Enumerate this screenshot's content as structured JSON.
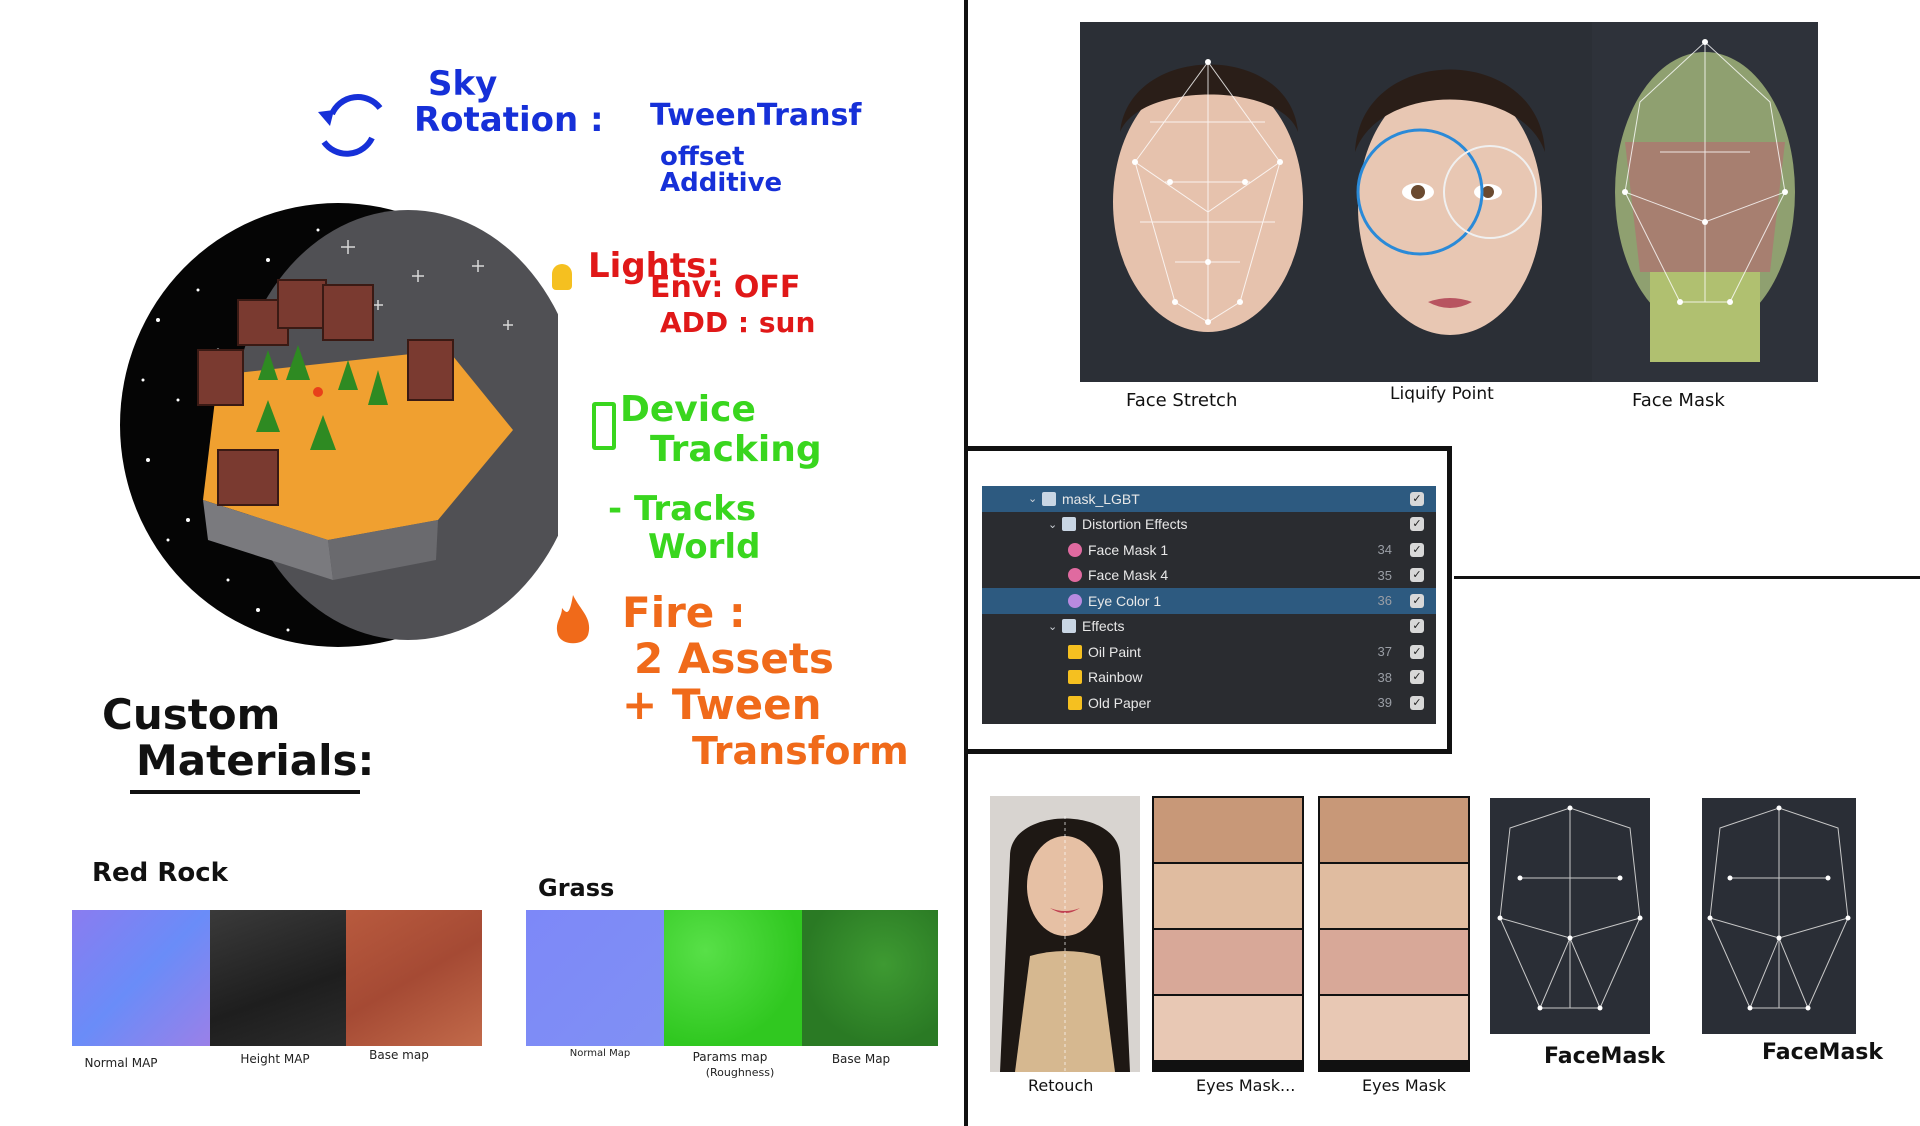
{
  "sketch": {
    "sky_rotation": {
      "title_line1": "Sky",
      "title_line2": "Rotation :",
      "items": [
        "TweenTransf",
        "offset",
        "Additive"
      ]
    },
    "lights": {
      "title": "Lights:",
      "items": [
        "Env: OFF",
        "ADD : sun"
      ]
    },
    "device_tracking": {
      "line1": "Device",
      "line2": "Tracking",
      "line3": "- Tracks",
      "line4": "World"
    },
    "fire": {
      "line1": "Fire :",
      "line2": "2 Assets",
      "line3": "+ Tween",
      "line4": "Transform"
    },
    "custom_materials": {
      "line1": "Custom",
      "line2": "Materials:"
    }
  },
  "materials": {
    "red_rock": {
      "title": "Red Rock",
      "labels": [
        "Normal MAP",
        "Height MAP",
        "Base map"
      ]
    },
    "grass": {
      "title": "Grass",
      "labels": [
        "Normal Map",
        "Params map",
        "(Roughness)",
        "Base Map"
      ]
    }
  },
  "faces": {
    "labels": [
      "Face Stretch",
      "Liquify Point",
      "Face Mask"
    ]
  },
  "layers": {
    "root": "mask_LGBT",
    "rows": [
      {
        "label": "Distortion Effects",
        "num": "",
        "level": 1,
        "kind": "group"
      },
      {
        "label": "Face Mask 1",
        "num": "34",
        "level": 2,
        "kind": "facemask"
      },
      {
        "label": "Face Mask 4",
        "num": "35",
        "level": 2,
        "kind": "facemask"
      },
      {
        "label": "Eye Color 1",
        "num": "36",
        "level": 2,
        "kind": "eye",
        "selected": true
      },
      {
        "label": "Effects",
        "num": "",
        "level": 1,
        "kind": "group"
      },
      {
        "label": "Oil Paint",
        "num": "37",
        "level": 2,
        "kind": "effect"
      },
      {
        "label": "Rainbow",
        "num": "38",
        "level": 2,
        "kind": "effect"
      },
      {
        "label": "Old Paper",
        "num": "39",
        "level": 2,
        "kind": "effect"
      }
    ]
  },
  "bottom": {
    "labels": [
      "Retouch",
      "Eyes Mask...",
      "Eyes Mask",
      "FaceMask",
      "FaceMask"
    ]
  },
  "colors": {
    "blue_ink": "#1630d8",
    "red_ink": "#e01818",
    "green_ink": "#39d61e",
    "orange_ink": "#f06a1a",
    "panel_bg": "#2a2c30",
    "panel_sel": "#2d5a80"
  }
}
